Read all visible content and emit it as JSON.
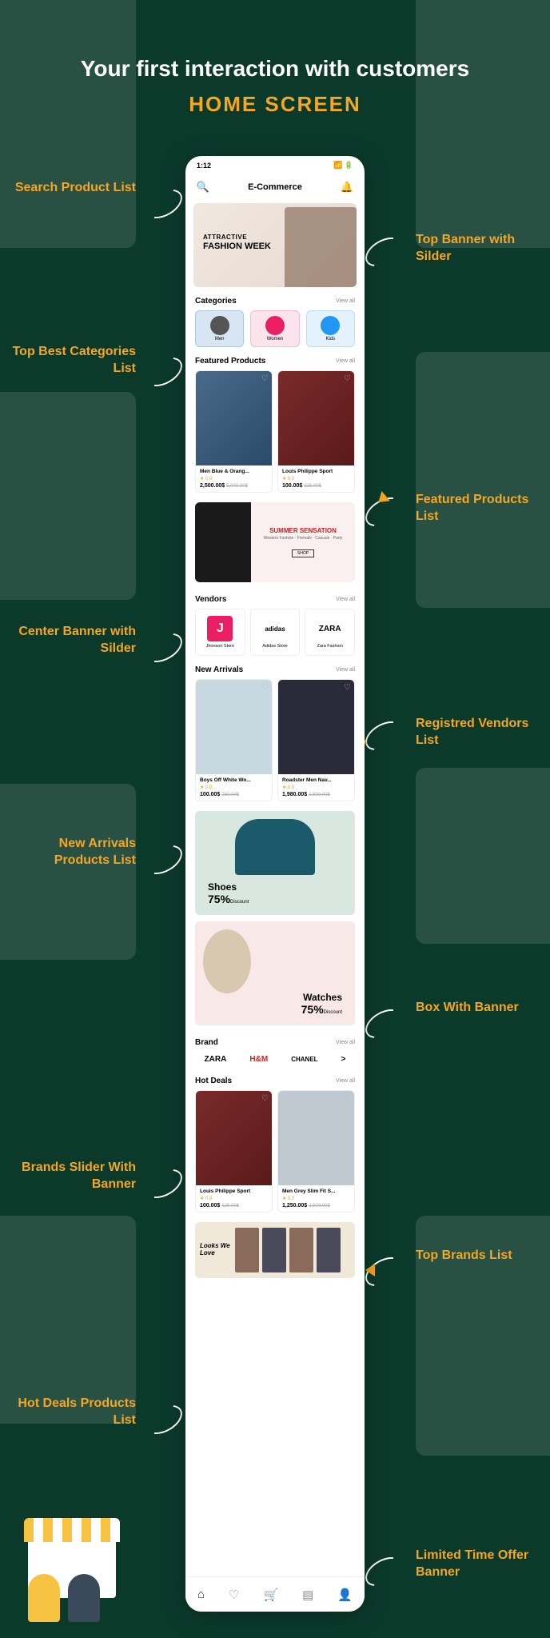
{
  "headline": "Your first interaction with customers",
  "subhead": "HOME SCREEN",
  "annotations": {
    "search": "Search Product List",
    "topbanner": "Top Banner with Silder",
    "categories": "Top Best Categories List",
    "featured": "Featured Products List",
    "centerbanner": "Center Banner with Silder",
    "vendors": "Registred Vendors List",
    "newarrivals": "New Arrivals Products List",
    "boxbanner": "Box With Banner",
    "brandslider": "Brands Slider With Banner",
    "topbrands": "Top Brands List",
    "hotdeals": "Hot Deals Products List",
    "limited": "Limited Time Offer Banner"
  },
  "status": {
    "time": "1:12"
  },
  "app_title": "E-Commerce",
  "banner": {
    "pre": "ATTRACTIVE",
    "title": "FASHION WEEK"
  },
  "sections": {
    "categories": {
      "title": "Categories",
      "viewall": "View all",
      "items": [
        {
          "label": "Men"
        },
        {
          "label": "Women"
        },
        {
          "label": "Kids"
        }
      ]
    },
    "featured": {
      "title": "Featured Products",
      "viewall": "View all",
      "items": [
        {
          "name": "Men Blue & Orang...",
          "rating": "★ 0.0",
          "price": "2,500.00$",
          "old": "5,000.00$"
        },
        {
          "name": "Louis Philippe Sport",
          "rating": "★ 0.0",
          "price": "100.00$",
          "old": "125.00$"
        }
      ]
    },
    "midbanner": {
      "title": "SUMMER SENSATION",
      "sub": "Western Fashion · Formals · Casuals · Party",
      "btn": "SHOP"
    },
    "vendors": {
      "title": "Vendors",
      "viewall": "View all",
      "items": [
        {
          "logo": "J",
          "name": "Jhonson Store"
        },
        {
          "logo": "adidas",
          "name": "Adidas Store"
        },
        {
          "logo": "ZARA",
          "name": "Zara Fashion"
        }
      ]
    },
    "newarrivals": {
      "title": "New Arrivals",
      "viewall": "View all",
      "items": [
        {
          "name": "Boys Off White Wo...",
          "rating": "★ 0.0",
          "price": "100.00$",
          "old": "250.00$"
        },
        {
          "name": "Roadster Men Nav...",
          "rating": "★ 0.0",
          "price": "1,980.00$",
          "old": "2,500.00$"
        }
      ]
    },
    "promo1": {
      "title": "Shoes",
      "disc": "75%",
      "sm": "Discount"
    },
    "promo2": {
      "title": "Watches",
      "disc": "75%",
      "sm": "Discount"
    },
    "brand": {
      "title": "Brand",
      "viewall": "View all",
      "items": [
        "ZARA",
        "H&M",
        "CHANEL",
        ">"
      ]
    },
    "hotdeals": {
      "title": "Hot Deals",
      "viewall": "View all",
      "items": [
        {
          "name": "Louis Philippe Sport",
          "rating": "★ 0.0",
          "price": "100.00$",
          "old": "125.00$"
        },
        {
          "name": "Men Grey Slim Fit S...",
          "rating": "★ 5.0",
          "price": "1,250.00$",
          "old": "2,500.00$"
        }
      ]
    },
    "offer": {
      "txt": "Looks We Love"
    }
  }
}
